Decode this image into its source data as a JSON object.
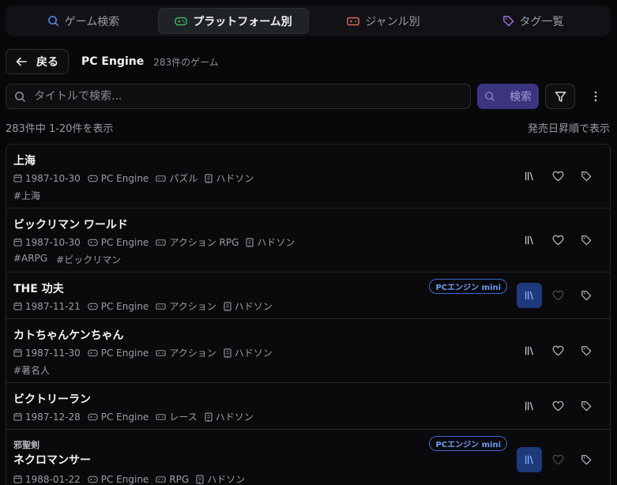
{
  "tabs": [
    {
      "label": "ゲーム検索",
      "icon": "search-icon",
      "active": false,
      "color": "#5b8def"
    },
    {
      "label": "プラットフォーム別",
      "icon": "gamepad-icon",
      "active": true,
      "color": "#3fbf6a"
    },
    {
      "label": "ジャンル別",
      "icon": "console-icon",
      "active": false,
      "color": "#e8705a"
    },
    {
      "label": "タグ一覧",
      "icon": "tag-icon",
      "active": false,
      "color": "#a76ee0"
    }
  ],
  "header": {
    "back_label": "戻る",
    "platform": "PC Engine",
    "count": "283件のゲーム"
  },
  "search": {
    "placeholder": "タイトルで検索...",
    "value": "",
    "button": "検索"
  },
  "results": {
    "info": "283件中 1-20件を表示",
    "sort": "発売日昇順で表示"
  },
  "colors": {
    "accent": "#3b3580",
    "badge": "#6e9cf2",
    "active_library": "#1e3a7a"
  },
  "games": [
    {
      "subtitle": "",
      "title": "上海",
      "date": "1987-10-30",
      "platform": "PC Engine",
      "genre": "パズル",
      "publisher": "ハドソン",
      "tags": [
        "#上海"
      ],
      "badge": "",
      "owned": false
    },
    {
      "subtitle": "",
      "title": "ビックリマン ワールド",
      "date": "1987-10-30",
      "platform": "PC Engine",
      "genre": "アクション RPG",
      "publisher": "ハドソン",
      "tags": [
        "#ARPG",
        "#ビックリマン"
      ],
      "badge": "",
      "owned": false
    },
    {
      "subtitle": "",
      "title": "THE 功夫",
      "date": "1987-11-21",
      "platform": "PC Engine",
      "genre": "アクション",
      "publisher": "ハドソン",
      "tags": [],
      "badge": "PCエンジン mini",
      "owned": true
    },
    {
      "subtitle": "",
      "title": "カトちゃんケンちゃん",
      "date": "1987-11-30",
      "platform": "PC Engine",
      "genre": "アクション",
      "publisher": "ハドソン",
      "tags": [
        "#著名人"
      ],
      "badge": "",
      "owned": false
    },
    {
      "subtitle": "",
      "title": "ビクトリーラン",
      "date": "1987-12-28",
      "platform": "PC Engine",
      "genre": "レース",
      "publisher": "ハドソン",
      "tags": [],
      "badge": "",
      "owned": false
    },
    {
      "subtitle": "邪聖剣",
      "title": "ネクロマンサー",
      "date": "1988-01-22",
      "platform": "PC Engine",
      "genre": "RPG",
      "publisher": "ハドソン",
      "tags": [],
      "badge": "PCエンジン mini",
      "owned": true
    }
  ]
}
